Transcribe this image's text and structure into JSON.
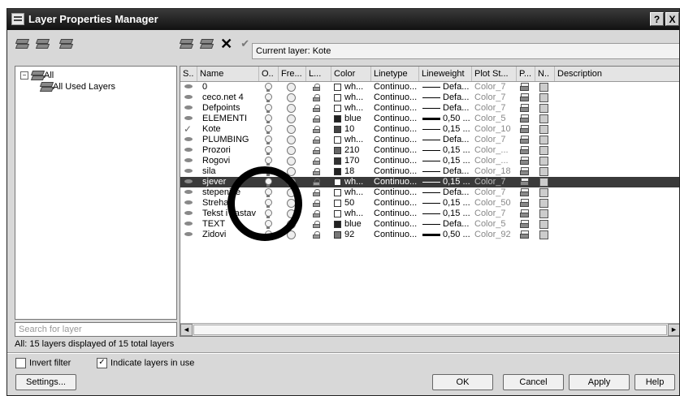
{
  "window": {
    "title": "Layer Properties Manager",
    "help_label": "?",
    "close_label": "X"
  },
  "toolbar": {
    "current_layer_text": "Current layer: Kote"
  },
  "tree": {
    "root_label": "All",
    "expander": "−",
    "child_label": "All Used Layers"
  },
  "search": {
    "placeholder": "Search for layer"
  },
  "columns": [
    "S..",
    "Name",
    "O..",
    "Fre...",
    "L...",
    "Color",
    "Linetype",
    "Lineweight",
    "Plot St...",
    "P...",
    "N..",
    "Description"
  ],
  "layers": [
    {
      "name": "0",
      "color_name": "wh...",
      "color_hex": "#ffffff",
      "linetype": "Continuo...",
      "lineweight": "Defa...",
      "lw_thick": false,
      "plot_style": "Color_7",
      "current": false,
      "selected": false
    },
    {
      "name": "ceco.net 4",
      "color_name": "wh...",
      "color_hex": "#ffffff",
      "linetype": "Continuo...",
      "lineweight": "Defa...",
      "lw_thick": false,
      "plot_style": "Color_7",
      "current": false,
      "selected": false
    },
    {
      "name": "Defpoints",
      "color_name": "wh...",
      "color_hex": "#ffffff",
      "linetype": "Continuo...",
      "lineweight": "Defa...",
      "lw_thick": false,
      "plot_style": "Color_7",
      "current": false,
      "selected": false
    },
    {
      "name": "ELEMENTI",
      "color_name": "blue",
      "color_hex": "#222222",
      "linetype": "Continuo...",
      "lineweight": "0,50 ...",
      "lw_thick": true,
      "plot_style": "Color_5",
      "current": false,
      "selected": false
    },
    {
      "name": "Kote",
      "color_name": "10",
      "color_hex": "#444444",
      "linetype": "Continuo...",
      "lineweight": "0,15 ...",
      "lw_thick": false,
      "plot_style": "Color_10",
      "current": true,
      "selected": false
    },
    {
      "name": "PLUMBING",
      "color_name": "wh...",
      "color_hex": "#ffffff",
      "linetype": "Continuo...",
      "lineweight": "Defa...",
      "lw_thick": false,
      "plot_style": "Color_7",
      "current": false,
      "selected": false
    },
    {
      "name": "Prozori",
      "color_name": "210",
      "color_hex": "#666666",
      "linetype": "Continuo...",
      "lineweight": "0,15 ...",
      "lw_thick": false,
      "plot_style": "Color_...",
      "current": false,
      "selected": false
    },
    {
      "name": "Rogovi",
      "color_name": "170",
      "color_hex": "#333333",
      "linetype": "Continuo...",
      "lineweight": "0,15 ...",
      "lw_thick": false,
      "plot_style": "Color_...",
      "current": false,
      "selected": false
    },
    {
      "name": "sila",
      "color_name": "18",
      "color_hex": "#222222",
      "linetype": "Continuo...",
      "lineweight": "Defa...",
      "lw_thick": false,
      "plot_style": "Color_18",
      "current": false,
      "selected": false
    },
    {
      "name": "sjever",
      "color_name": "wh...",
      "color_hex": "#ffffff",
      "linetype": "Continuo...",
      "lineweight": "0,15 ...",
      "lw_thick": false,
      "plot_style": "Color_7",
      "current": false,
      "selected": true
    },
    {
      "name": "stepenice",
      "color_name": "wh...",
      "color_hex": "#ffffff",
      "linetype": "Continuo...",
      "lineweight": "Defa...",
      "lw_thick": false,
      "plot_style": "Color_7",
      "current": false,
      "selected": false
    },
    {
      "name": "Streha",
      "color_name": "50",
      "color_hex": "#ffffff",
      "linetype": "Continuo...",
      "lineweight": "0,15 ...",
      "lw_thick": false,
      "plot_style": "Color_50",
      "current": false,
      "selected": false
    },
    {
      "name": "Tekst i sastav",
      "color_name": "wh...",
      "color_hex": "#ffffff",
      "linetype": "Continuo...",
      "lineweight": "0,15 ...",
      "lw_thick": false,
      "plot_style": "Color_7",
      "current": false,
      "selected": false
    },
    {
      "name": "TEXT",
      "color_name": "blue",
      "color_hex": "#222222",
      "linetype": "Continuo...",
      "lineweight": "Defa...",
      "lw_thick": false,
      "plot_style": "Color_5",
      "current": false,
      "selected": false
    },
    {
      "name": "Zidovi",
      "color_name": "92",
      "color_hex": "#777777",
      "linetype": "Continuo...",
      "lineweight": "0,50 ...",
      "lw_thick": true,
      "plot_style": "Color_92",
      "current": false,
      "selected": false
    }
  ],
  "summary": "All: 15 layers displayed of 15 total layers",
  "options": {
    "invert_filter": "Invert filter",
    "invert_checked": false,
    "indicate_in_use": "Indicate layers in use",
    "indicate_checked": true,
    "check_mark": "✓"
  },
  "scroll": {
    "left_arrow": "◄",
    "right_arrow": "►"
  },
  "buttons": {
    "settings": "Settings...",
    "ok": "OK",
    "cancel": "Cancel",
    "apply": "Apply",
    "help": "Help"
  }
}
